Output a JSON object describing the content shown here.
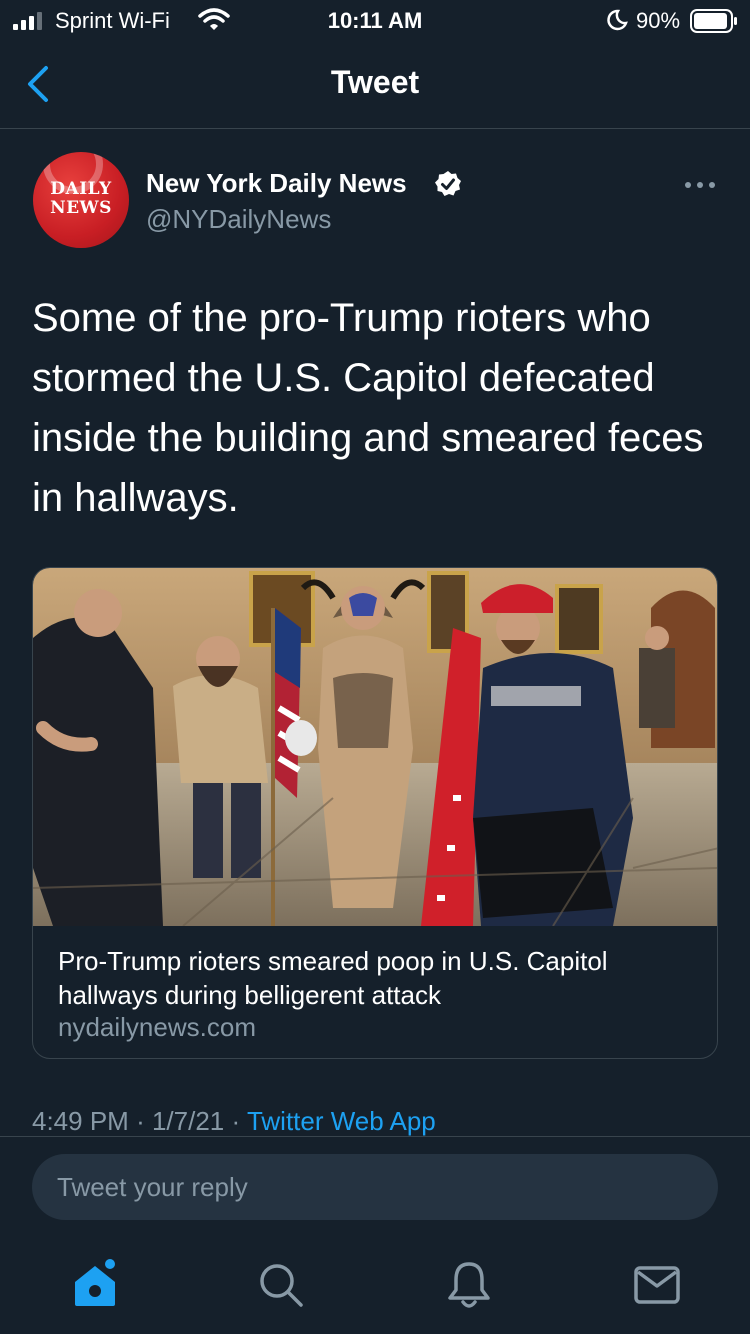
{
  "status_bar": {
    "carrier": "Sprint Wi-Fi",
    "time": "10:11 AM",
    "battery": "90%"
  },
  "nav": {
    "title": "Tweet"
  },
  "tweet": {
    "author": {
      "avatar_text": "DAILY NEWS",
      "display_name": "New York Daily News",
      "handle": "@NYDailyNews",
      "verified": true
    },
    "text": "Some of the pro-Trump rioters who stormed the U.S. Capitol defecated inside the building and smeared feces in hallways.",
    "card": {
      "title": "Pro-Trump rioters smeared poop in U.S. Capitol hallways during belligerent attack",
      "domain": "nydailynews.com"
    },
    "time": "4:49 PM",
    "date": "1/7/21",
    "separator": "·",
    "source": "Twitter Web App"
  },
  "reply": {
    "placeholder": "Tweet your reply"
  },
  "tab_bar": {
    "items": [
      "home-icon",
      "search-icon",
      "bell-icon",
      "mail-icon"
    ]
  },
  "colors": {
    "background": "#15202b",
    "accent": "#1da1f2",
    "muted": "#8899a6",
    "border": "#38444d"
  }
}
